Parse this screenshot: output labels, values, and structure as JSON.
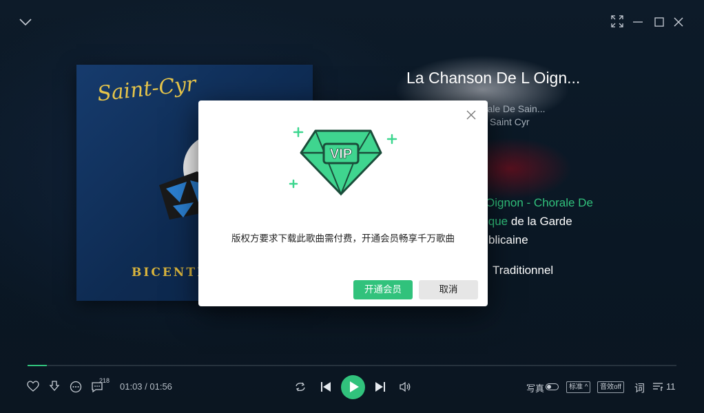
{
  "song": {
    "title": "La Chanson De L Oign...",
    "artist": "orale De Sain...",
    "album": "Saint Cyr"
  },
  "cover": {
    "script_text": "Saint-Cyr",
    "bottom_text": "BICENTE"
  },
  "lyrics": {
    "line1_green": "Oignon - Chorale De",
    "line2_green": "ique",
    "line2_white": " de la Garde",
    "line3": "blicaine",
    "line4": "Traditionnel"
  },
  "player": {
    "time": "01:03 / 01:56",
    "progress": 0.03,
    "comment_count": "218",
    "portrait_label": "写真",
    "quality_label": "标准",
    "effect_label": "音效off",
    "lyrics_label": "词",
    "playlist_count": "11"
  },
  "dialog": {
    "vip_text": "VIP",
    "message": "版权方要求下载此歌曲需付费，开通会员畅享千万歌曲",
    "confirm_label": "开通会员",
    "cancel_label": "取消"
  },
  "colors": {
    "accent": "#31c27c",
    "gem_dark": "#1a4d3a"
  }
}
